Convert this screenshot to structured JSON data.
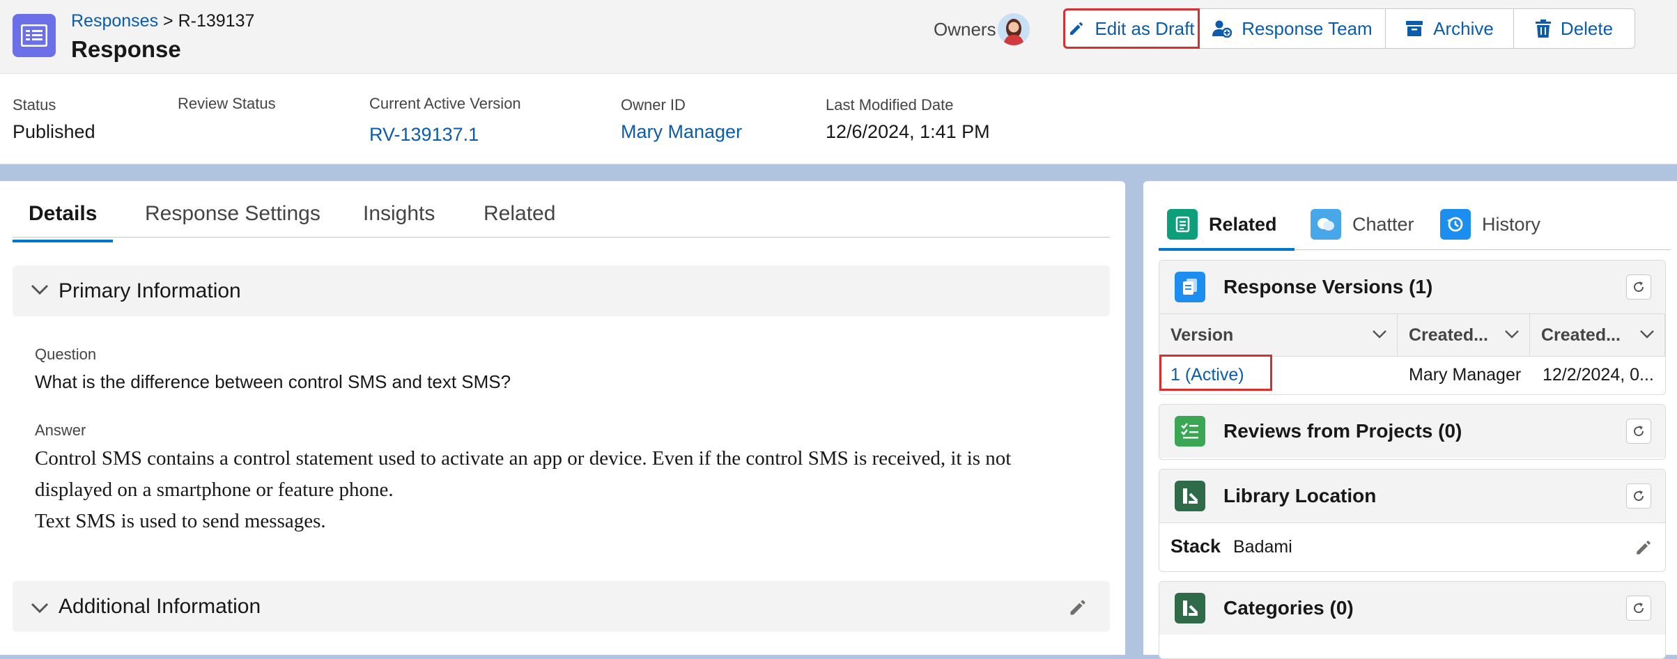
{
  "header": {
    "breadcrumb_parent": "Responses",
    "breadcrumb_separator": ">",
    "breadcrumb_current": "R-139137",
    "object_label": "Response",
    "owners_label": "Owners",
    "buttons": {
      "edit_as_draft": "Edit as Draft",
      "response_team": "Response Team",
      "archive": "Archive",
      "delete": "Delete"
    }
  },
  "highlights": {
    "status": {
      "label": "Status",
      "value": "Published"
    },
    "review_status": {
      "label": "Review Status",
      "value": ""
    },
    "current_active_version": {
      "label": "Current Active Version",
      "value": "RV-139137.1"
    },
    "owner_id": {
      "label": "Owner ID",
      "value": "Mary Manager"
    },
    "last_modified_date": {
      "label": "Last Modified Date",
      "value": "12/6/2024, 1:41 PM"
    }
  },
  "left": {
    "tabs": [
      "Details",
      "Response Settings",
      "Insights",
      "Related"
    ],
    "primary_section": "Primary Information",
    "question_label": "Question",
    "question_value": "What is the difference between control SMS and text SMS?",
    "answer_label": "Answer",
    "answer_line1": "Control SMS contains a control statement used to activate an app or device. Even if the control SMS is received, it is not",
    "answer_line2": "displayed on a smartphone or feature phone.",
    "answer_line3": "Text SMS is used to send messages.",
    "additional_section": "Additional Information"
  },
  "right": {
    "tabs": [
      "Related",
      "Chatter",
      "History"
    ],
    "response_versions": {
      "title": "Response Versions (1)",
      "columns": [
        "Version",
        "Created...",
        "Created..."
      ],
      "row": {
        "version": "1 (Active)",
        "created_by": "Mary Manager",
        "created_date": "12/2/2024, 0..."
      }
    },
    "reviews": {
      "title": "Reviews from Projects (0)"
    },
    "library_location": {
      "title": "Library Location",
      "stack_label": "Stack",
      "stack_value": "Badami"
    },
    "categories": {
      "title": "Categories (0)"
    }
  },
  "colors": {
    "brand_blue": "#0176d3",
    "link_blue": "#0b5cab",
    "highlight_red": "#d62f2f",
    "app_icon": "#6b6fe8",
    "background": "#b0c4df"
  },
  "icons": [
    "list-icon",
    "pencil-icon",
    "person-add-icon",
    "archive-icon",
    "trash-icon",
    "chevron-down-icon",
    "refresh-icon",
    "related-icon",
    "chatter-icon",
    "history-icon",
    "versions-icon",
    "reviews-icon",
    "library-icon",
    "categories-icon"
  ]
}
